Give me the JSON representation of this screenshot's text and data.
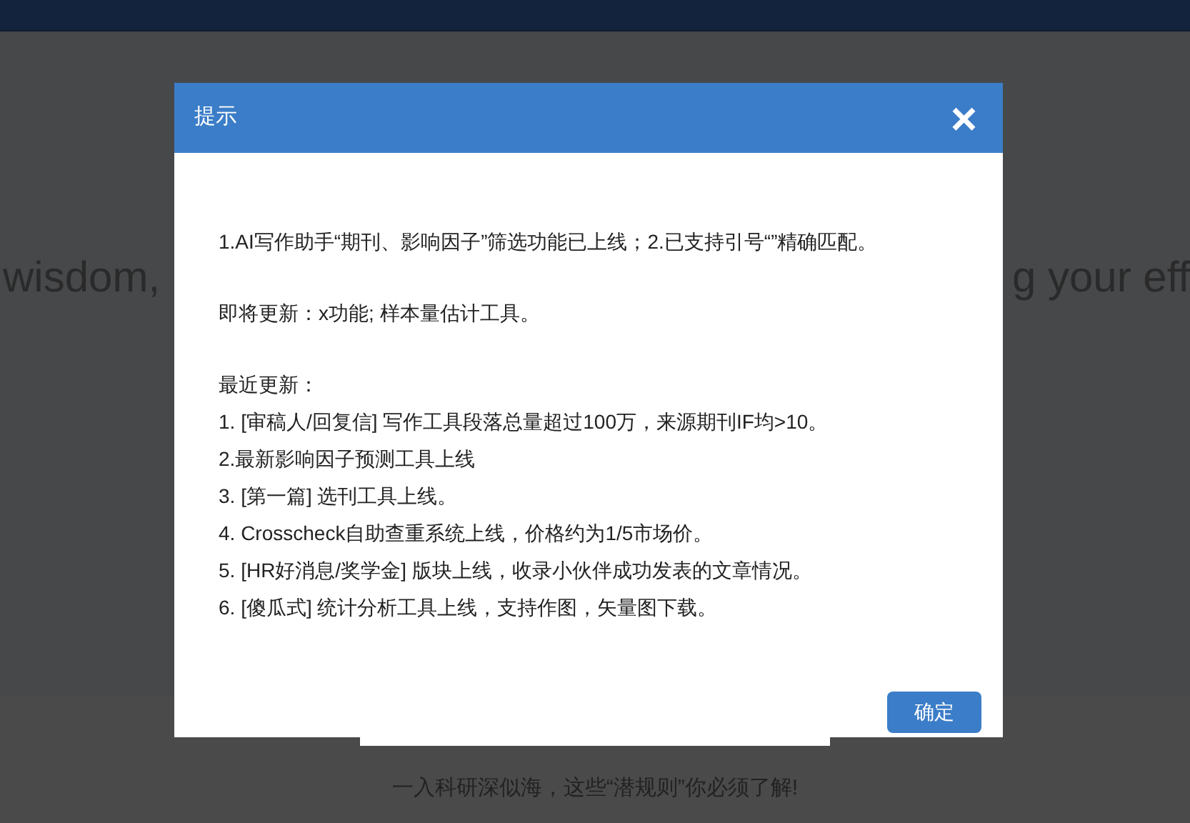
{
  "page": {
    "banner_left": "wisdom,",
    "banner_right": "g your eff",
    "article_title": "一入科研深似海，这些“潜规则”你必须了解!"
  },
  "dialog": {
    "title": "提示",
    "close": "×",
    "paragraphs": [
      "1.AI写作助手“期刊、影响因子”筛选功能已上线；2.已支持引号“”精确匹配。",
      "即将更新：x功能; 样本量估计工具。"
    ],
    "recent_heading": "最近更新：",
    "recent_items": [
      "1. [审稿人/回复信] 写作工具段落总量超过100万，来源期刊IF均>10。",
      "2.最新影响因子预测工具上线",
      "3. [第一篇] 选刊工具上线。",
      "4. Crosscheck自助查重系统上线，价格约为1/5市场价。",
      "5. [HR好消息/奖学金] 版块上线，收录小伙伴成功发表的文章情况。",
      "6. [傻瓜式] 统计分析工具上线，支持作图，矢量图下载。"
    ],
    "confirm": "确定"
  }
}
